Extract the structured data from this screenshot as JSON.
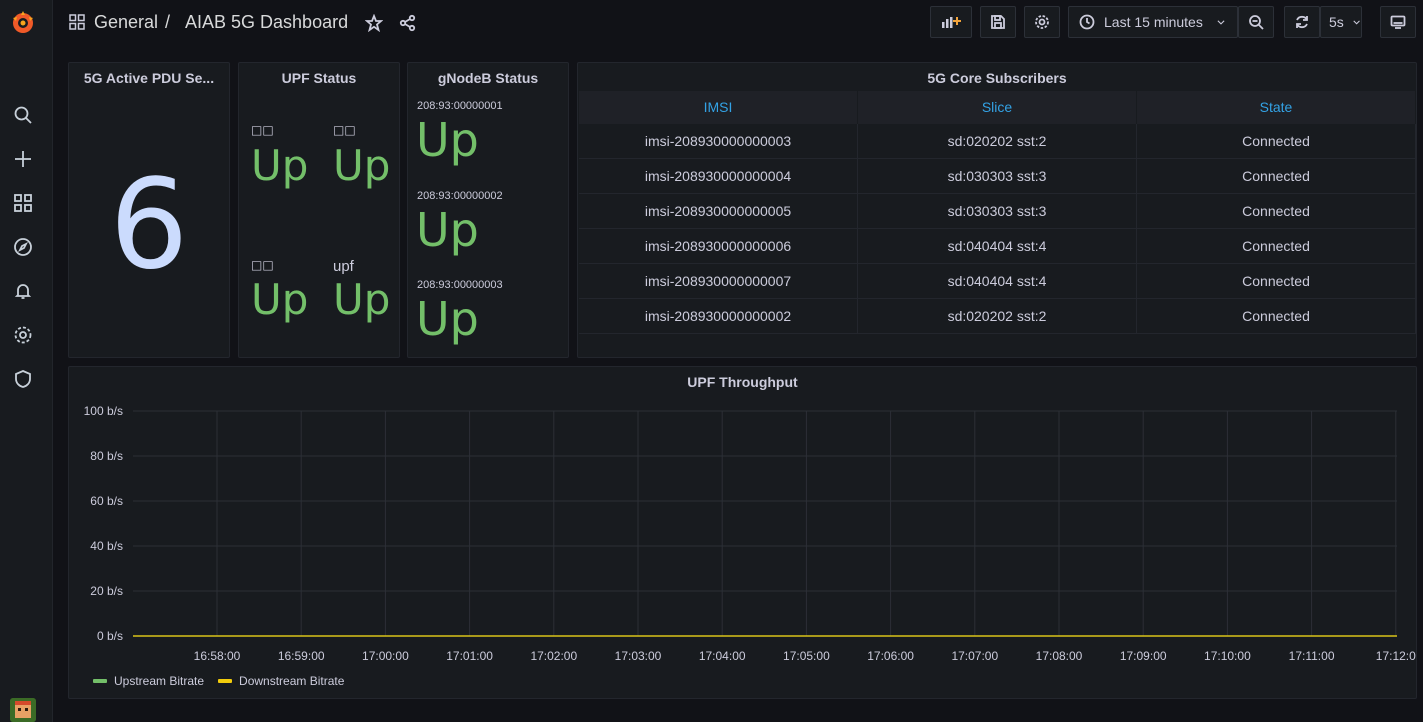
{
  "breadcrumb": {
    "folder": "General",
    "separator": "/",
    "dashboard": "AIAB 5G Dashboard"
  },
  "toolbar": {
    "time_range": "Last 15 minutes",
    "refresh_interval": "5s"
  },
  "panels": {
    "pdu": {
      "title": "5G Active PDU Se...",
      "value": "6"
    },
    "upf": {
      "title": "UPF Status",
      "items": [
        {
          "label": "□□",
          "status": "Up"
        },
        {
          "label": "□□",
          "status": "Up"
        },
        {
          "label": "□□",
          "status": "Up"
        },
        {
          "label": "upf",
          "status": "Up"
        }
      ]
    },
    "gnodeb": {
      "title": "gNodeB Status",
      "items": [
        {
          "label": "208:93:00000001",
          "status": "Up"
        },
        {
          "label": "208:93:00000002",
          "status": "Up"
        },
        {
          "label": "208:93:00000003",
          "status": "Up"
        }
      ]
    },
    "subscribers": {
      "title": "5G Core Subscribers",
      "columns": [
        "IMSI",
        "Slice",
        "State"
      ],
      "rows": [
        [
          "imsi-208930000000003",
          "sd:020202 sst:2",
          "Connected"
        ],
        [
          "imsi-208930000000004",
          "sd:030303 sst:3",
          "Connected"
        ],
        [
          "imsi-208930000000005",
          "sd:030303 sst:3",
          "Connected"
        ],
        [
          "imsi-208930000000006",
          "sd:040404 sst:4",
          "Connected"
        ],
        [
          "imsi-208930000000007",
          "sd:040404 sst:4",
          "Connected"
        ],
        [
          "imsi-208930000000002",
          "sd:020202 sst:2",
          "Connected"
        ]
      ]
    },
    "throughput": {
      "title": "UPF Throughput"
    }
  },
  "chart_data": {
    "type": "line",
    "title": "UPF Throughput",
    "y_ticks": [
      "100 b/s",
      "80 b/s",
      "60 b/s",
      "40 b/s",
      "20 b/s",
      "0 b/s"
    ],
    "ylim": [
      0,
      100
    ],
    "x_ticks": [
      "16:58:00",
      "16:59:00",
      "17:00:00",
      "17:01:00",
      "17:02:00",
      "17:03:00",
      "17:04:00",
      "17:05:00",
      "17:06:00",
      "17:07:00",
      "17:08:00",
      "17:09:00",
      "17:10:00",
      "17:11:00",
      "17:12:0"
    ],
    "series": [
      {
        "name": "Upstream Bitrate",
        "color": "#73bf69",
        "values": [
          0,
          0
        ]
      },
      {
        "name": "Downstream Bitrate",
        "color": "#f2cc0c",
        "values": [
          0,
          0
        ]
      }
    ],
    "grid": true,
    "legend": "bottom-left"
  },
  "colors": {
    "status_up": "#73bf69",
    "stat_value": "#cbdbfd",
    "table_header": "#33a2e5"
  }
}
